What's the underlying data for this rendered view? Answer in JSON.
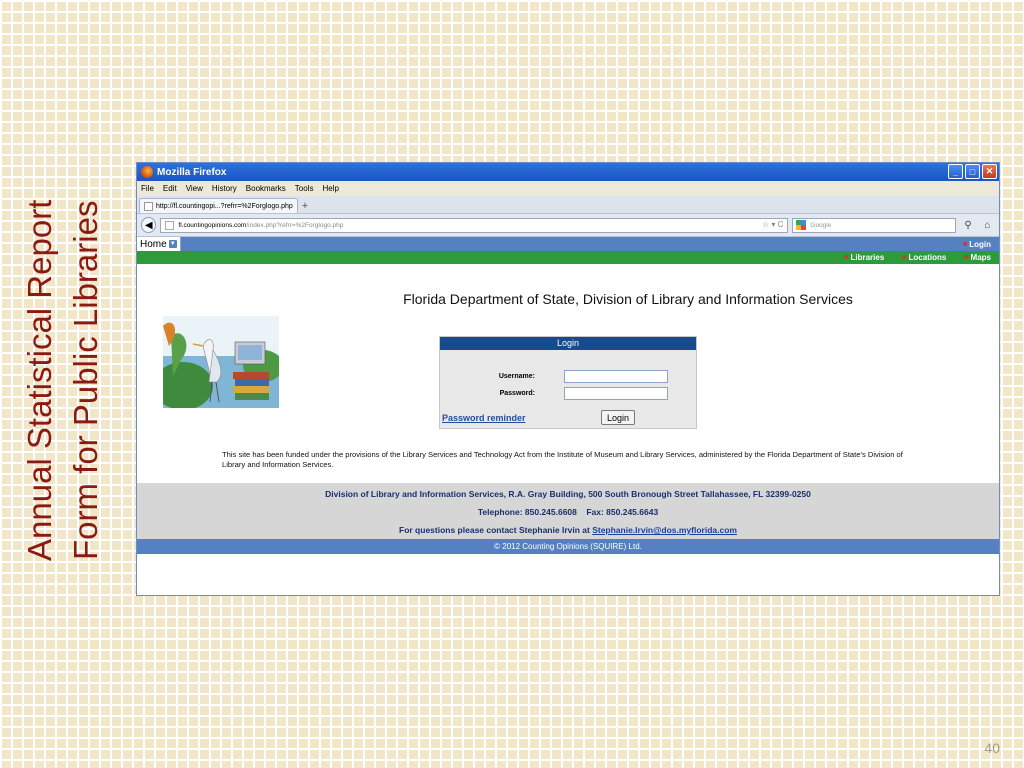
{
  "slide": {
    "title_line1": "Annual Statistical Report",
    "title_line2": "Form for Public Libraries",
    "page_number": "40"
  },
  "browser": {
    "window_title": "Mozilla Firefox",
    "window_buttons": {
      "minimize": "_",
      "maximize": "□",
      "close": "✕"
    },
    "menu": [
      "File",
      "Edit",
      "View",
      "History",
      "Bookmarks",
      "Tools",
      "Help"
    ],
    "tab_title": "http://fl.countingopi...?refrr=%2Forglogo.php",
    "new_tab": "+",
    "url_domain": "fl.countingopinions.com",
    "url_path": "/index.php?refrr=%2Forglogo.php",
    "url_tools": "☆ ▾ C",
    "search_placeholder": "Google"
  },
  "site": {
    "nav": {
      "home": "Home",
      "login": "Login",
      "libraries": "Libraries",
      "locations": "Locations",
      "maps": "Maps"
    },
    "heading": "Florida Department of State, Division of Library and Information Services",
    "login_form": {
      "header": "Login",
      "username_label": "Username:",
      "password_label": "Password:",
      "username_value": "",
      "password_value": "",
      "reminder_link": "Password reminder",
      "submit_label": "Login"
    },
    "funding_text": "This site has been funded under the provisions of the Library Services and Technology Act from the Institute of Museum and Library Services, administered by the Florida Department of State's Division of Library and Information Services.",
    "footer": {
      "address": "Division of Library and Information Services, R.A. Gray Building, 500 South Bronough Street Tallahassee, FL 32399-0250",
      "phone": "Telephone: 850.245.6608    Fax: 850.245.6643",
      "contact_prefix": "For questions please contact Stephanie Irvin at ",
      "contact_email": "Stephanie.Irvin@dos.myflorida.com",
      "copyright": "© 2012 Counting Opinions (SQUIRE) Ltd."
    }
  },
  "colors": {
    "slide_title": "#8b1a12",
    "nav_blue": "#5580c2",
    "nav_green": "#2e9a3a",
    "login_header": "#174b8e"
  }
}
